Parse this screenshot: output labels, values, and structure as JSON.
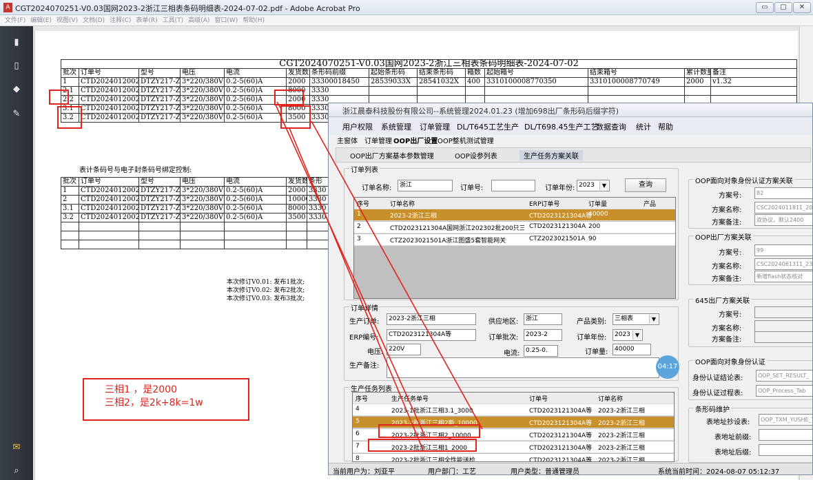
{
  "window": {
    "title": "CGT2024070251-V0.03国网2023-2浙江三相表条码明细表-2024-07-02.pdf - Adobe Acrobat Pro",
    "min": "▭",
    "max": "▢",
    "close": "✕"
  },
  "menu": [
    "文件(F)",
    "编辑(E)",
    "视图(V)",
    "文档(D)",
    "注释(C)",
    "表单(R)",
    "工具(T)",
    "高级(A)",
    "窗口(W)",
    "帮助(H)"
  ],
  "left_icons": [
    "pages-icon",
    "bookmark-icon",
    "layers-icon",
    "signature-icon",
    "comment-icon",
    "attachment-icon"
  ],
  "pdf": {
    "title": "CGT2024070251-V0.03国网2023-2浙江三相表条码明细表-2024-07-02",
    "headers": [
      "批次",
      "订单号",
      "型号",
      "电压",
      "电流",
      "发货数量",
      "条形码前缀",
      "起始条形码",
      "结束条形码",
      "箱数",
      "起始箱号",
      "结束箱号",
      "累计数量",
      "备注"
    ],
    "rows": [
      [
        "1",
        "CTD20240120024",
        "DTZY217-Z",
        "3*220/380V",
        "0.2-5(60)A",
        "2000",
        "33300018450",
        "28539033X",
        "28541032X",
        "400",
        "3310100008770350",
        "3310100008770749",
        "2000",
        "v1.32"
      ],
      [
        "2.1",
        "CTD20240120024",
        "DTZY217-Z",
        "3*220/380V",
        "0.2-5(60)A",
        "8000",
        "3330",
        "",
        "",
        "",
        "",
        "",
        "",
        ""
      ],
      [
        "2.2",
        "CTD20240120024",
        "DTZY217-Z",
        "3*220/380V",
        "0.2-5(60)A",
        "2000",
        "3330",
        "",
        "",
        "",
        "",
        "",
        "",
        ""
      ],
      [
        "3.1",
        "CTD20240120024",
        "DTZY217-Z",
        "3*220/380V",
        "0.2-5(60)A",
        "8000",
        "3330",
        "",
        "",
        "",
        "",
        "",
        "",
        ""
      ],
      [
        "3.2",
        "CTD20240120024",
        "DTZY217-Z",
        "3*220/380V",
        "0.2-5(60)A",
        "3500",
        "3330",
        "",
        "",
        "",
        "",
        "",
        "",
        ""
      ]
    ],
    "section2_title": "表计条码号与电子封条码号绑定控制:",
    "headers2": [
      "批次",
      "订单号",
      "型号",
      "电压",
      "电流",
      "发货数量",
      "条形"
    ],
    "rows2": [
      [
        "1",
        "CTD20240120024",
        "DTZY217-Z",
        "3*220/380V",
        "0.2-5(60)A",
        "2000",
        "3330"
      ],
      [
        "2",
        "CTD20240120024",
        "DTZY217-Z",
        "3*220/380V",
        "0.2-5(60)A",
        "10000",
        "3330"
      ],
      [
        "3.1",
        "CTD20240120024",
        "DTZY217-Z",
        "3*220/380V",
        "0.2-5(60)A",
        "8000",
        "3330"
      ],
      [
        "3.2",
        "CTD20240120024",
        "DTZY217-Z",
        "3*220/380V",
        "0.2-5(60)A",
        "3500",
        "3330"
      ]
    ],
    "revisions": [
      "本次修订V0.01: 发布1批次;",
      "本次修订V0.02: 发布2批次;",
      "本次修订V0.03: 发布3批次;"
    ]
  },
  "note": [
    "三相1 ，是2000",
    "三相2，是2k+8k=1w"
  ],
  "app": {
    "title": "浙江晨泰科技股份有限公司--系统管理2024.01.23 (增加698出厂条形码后缀字符)",
    "menu": [
      "用户权限",
      "系统管理",
      "订单管理",
      "DL/T645工艺生产",
      "DL/T698.45生产工艺",
      "数据查询",
      "统计",
      "帮助"
    ],
    "tabs1": [
      "主窗体",
      "订单管理",
      "OOP出厂设置",
      "OOP整机测试管理"
    ],
    "tabs2": [
      "OOP出厂方案基本参数管理",
      "OOP设参列表",
      "生产任务方案关联"
    ],
    "order_list": {
      "legend": "订单列表",
      "name_label": "订单名称:",
      "name_value": "浙江",
      "no_label": "订单号:",
      "no_value": "",
      "year_label": "订单年份:",
      "year_value": "2023",
      "query": "查询",
      "headers": [
        "序号",
        "订单名称",
        "ERP订单号",
        "订单量",
        "产品"
      ],
      "rows": [
        [
          "1",
          "2023-2浙江三相",
          "CTD2023121304A等",
          "40000"
        ],
        [
          "2",
          "CTD2023121304A国网浙江202302批200只三...",
          "CTD2023121304A",
          "200"
        ],
        [
          "3",
          "CTZ2023021501A浙江图盛5套智能网关",
          "CTZ2023021501A",
          "90"
        ]
      ]
    },
    "order_detail": {
      "legend": "订单详情",
      "prod_label": "生产订单:",
      "prod_value": "2023-2浙江三相",
      "region_label": "供应地区:",
      "region_value": "浙江",
      "cat_label": "产品类别:",
      "cat_value": "三相表",
      "erp_label": "ERP编号:",
      "erp_value": "CTD2023121304A等",
      "batch_label": "订单批次:",
      "batch_value": "2023-2",
      "year_label": "订单年份:",
      "year_value": "2023",
      "volt_label": "电压:",
      "volt_value": "220V",
      "curr_label": "电流:",
      "curr_value": "0.25-0.",
      "qty_label": "订单量:",
      "qty_value": "40000",
      "remark_label": "生产备注:",
      "remark_value": ""
    },
    "task_list": {
      "legend": "生产任务列表",
      "headers": [
        "序号",
        "生产任务单号",
        "订单号",
        "订单名称"
      ],
      "rows": [
        [
          "4",
          "2023-1批浙江三相3.1_3000",
          "CTD2023121304A等",
          "2023-2浙江三相"
        ],
        [
          "5",
          "2023-2批浙江三相2新_10000",
          "CTD2023121304A等",
          "2023-2浙江三相"
        ],
        [
          "6",
          "2023-2批浙江三相2_10000",
          "CTD2023121304A等",
          "2023-2浙江三相"
        ],
        [
          "7",
          "2023-2批浙江三相1_2000",
          "CTD2023121304A等",
          "2023-2浙江三相"
        ],
        [
          "8",
          "2023-2批浙江三相全性能送检",
          "CTD2023121304A等",
          "2023-2浙江三相"
        ]
      ]
    },
    "oop_auth": {
      "legend": "OOP面向对象身份认证方案关联",
      "scheme_no_label": "方案号:",
      "scheme_no": "82",
      "scheme_name_label": "方案名称:",
      "scheme_name": "CSC2024011811_202",
      "scheme_note_label": "方案备注:",
      "scheme_note": "双协议，默认2400"
    },
    "oop_factory": {
      "legend": "OOP出厂方案关联",
      "scheme_no_label": "方案号:",
      "scheme_no": "99",
      "scheme_name_label": "方案名称:",
      "scheme_name": "CSC2024061311_23",
      "scheme_note_label": "方案备注:",
      "scheme_note": "新增flash状态核对"
    },
    "f645": {
      "legend": "645出厂方案关联",
      "scheme_no_label": "方案号:",
      "scheme_name_label": "方案名称:",
      "scheme_note_label": "方案备注:"
    },
    "oop_identity": {
      "legend": "OOP面向对象身份认证",
      "conclusion_label": "身份认证结论表:",
      "conclusion": "OOP_SET_RESULT_",
      "process_label": "身份认证过程表:",
      "process": "OOP_Process_Tab"
    },
    "barcode": {
      "legend": "条形码维护",
      "table_label": "表地址抄设表:",
      "table": "OOP_TXM_YUSHE_T",
      "prefix_label": "表地址前缀:",
      "suffix_label": "表地址后缀:"
    },
    "timer": "04:17",
    "status": {
      "user": "当前用户为：刘亚平",
      "dept": "用户部门：工艺",
      "type": "用户类型：普通管理员",
      "time": "系统当前时间：2024-08-07 05:12:37"
    }
  }
}
